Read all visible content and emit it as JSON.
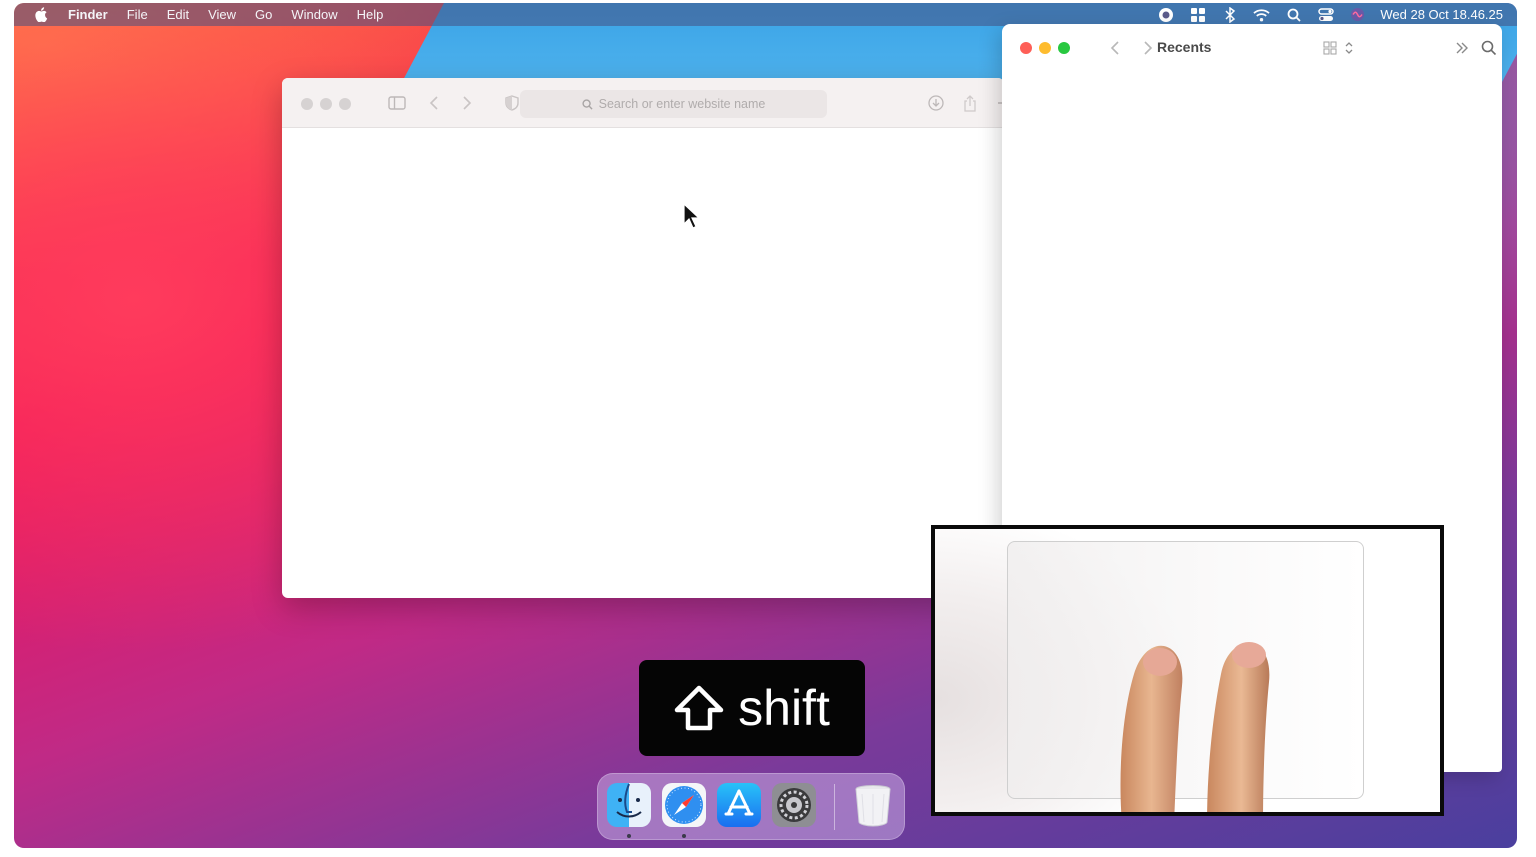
{
  "menubar": {
    "app_name": "Finder",
    "items": [
      "File",
      "Edit",
      "View",
      "Go",
      "Window",
      "Help"
    ],
    "status_icons": [
      "screen-record-icon",
      "control-grid-icon",
      "bluetooth-icon",
      "wifi-icon",
      "spotlight-search-icon",
      "control-center-icon",
      "siri-icon"
    ],
    "clock": "Wed 28 Oct  18.46.25"
  },
  "safari": {
    "address_placeholder": "Search or enter website name"
  },
  "finder": {
    "title": "Recents",
    "traffic_lights": {
      "close": "#fe5f57",
      "minimize": "#febc2e",
      "zoom": "#28c840"
    }
  },
  "overlay": {
    "key_label": "shift",
    "key_icon": "shift-arrow-icon"
  },
  "dock": {
    "apps": [
      {
        "name": "Finder",
        "icon": "finder-icon",
        "running": true
      },
      {
        "name": "Safari",
        "icon": "safari-icon",
        "running": true
      },
      {
        "name": "App Store",
        "icon": "app-store-icon",
        "running": false
      },
      {
        "name": "System Preferences",
        "icon": "system-preferences-icon",
        "running": false
      },
      {
        "name": "Trash",
        "icon": "trash-icon",
        "running": false
      }
    ]
  },
  "inset": {
    "description_icon": "trackpad-two-finger-gesture"
  }
}
